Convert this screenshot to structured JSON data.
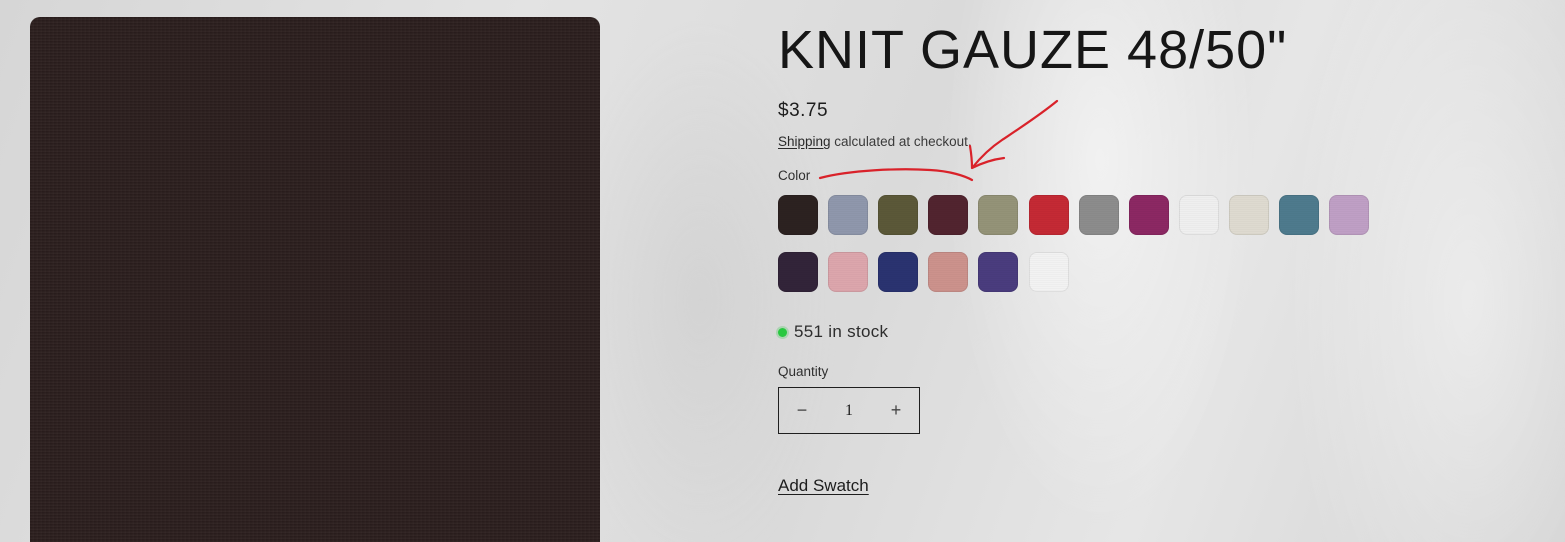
{
  "product": {
    "title": "KNIT GAUZE 48/50\"",
    "price": "$3.75",
    "shipping_link": "Shipping",
    "shipping_text": " calculated at checkout.",
    "color_label": "Color",
    "colors": {
      "row1": [
        "#2d2221",
        "#929aaf",
        "#5d5a39",
        "#532430",
        "#97967a",
        "#c82a35",
        "#8f8f8f",
        "#8e2965",
        "#f4f4f4",
        "#e3dfd4",
        "#4f7d90",
        "#c3a2c9"
      ],
      "row2": [
        "#33243a",
        "#e1a9b0",
        "#2b3473",
        "#d0958f",
        "#4b3d80",
        "#f7f7f7"
      ]
    },
    "stock_text": "551 in stock",
    "stock_color": "#28c840",
    "quantity_label": "Quantity",
    "quantity_value": "1",
    "qty_minus": "−",
    "qty_plus": "+",
    "add_swatch": "Add Swatch"
  },
  "annotation_color": "#d9222a"
}
